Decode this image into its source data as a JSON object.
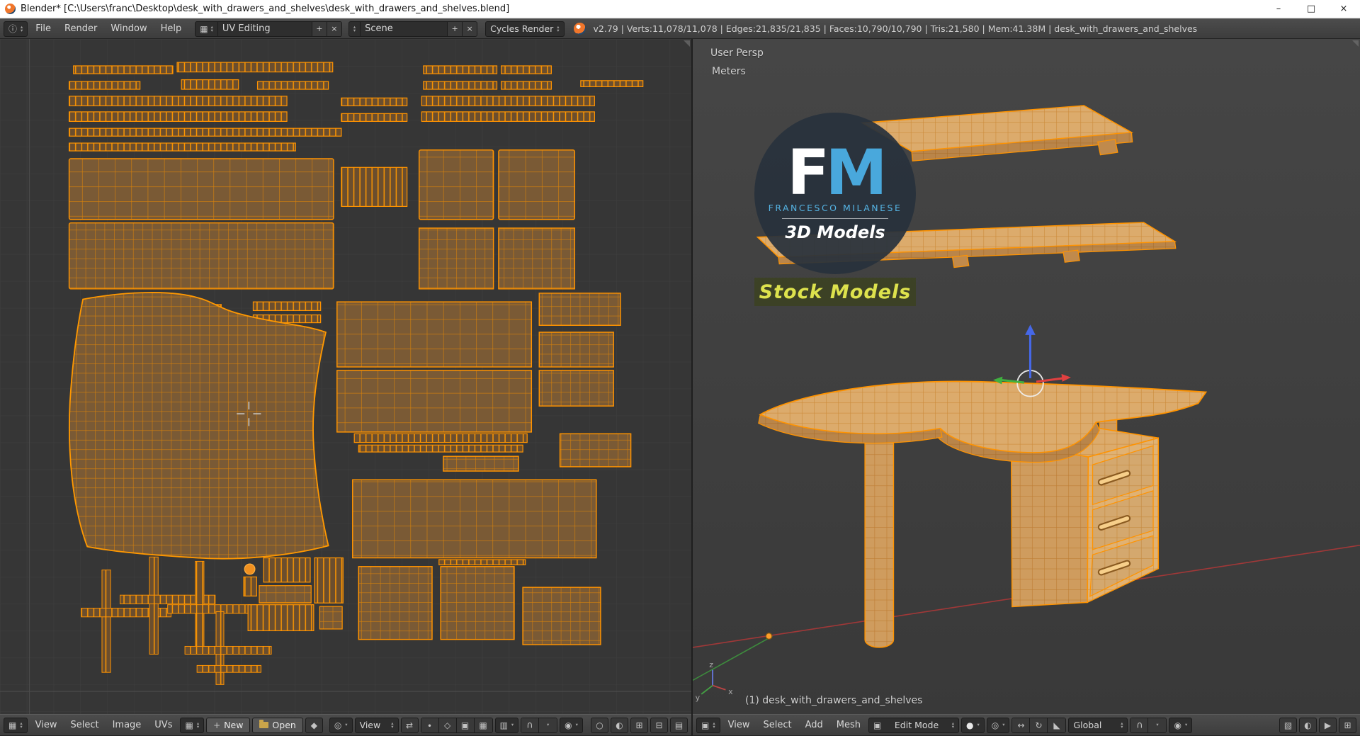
{
  "window": {
    "title": "Blender* [C:\\Users\\franc\\Desktop\\desk_with_drawers_and_shelves\\desk_with_drawers_and_shelves.blend]",
    "minimize": "–",
    "maximize": "□",
    "close": "×"
  },
  "topbar": {
    "menus": [
      "File",
      "Render",
      "Window",
      "Help"
    ],
    "layout_name": "UV Editing",
    "scene_name": "Scene",
    "engine": "Cycles Render",
    "stats": "v2.79 | Verts:11,078/11,078 | Edges:21,835/21,835 | Faces:10,790/10,790 | Tris:21,580 | Mem:41.38M | desk_with_drawers_and_shelves"
  },
  "uv_editor": {
    "menus": [
      "View",
      "Select",
      "Image",
      "UVs"
    ],
    "new_label": "New",
    "open_label": "Open",
    "channel_dropdown": "View"
  },
  "viewport": {
    "view_label": "User Persp",
    "unit_label": "Meters",
    "object_label": "(1) desk_with_drawers_and_shelves",
    "menus": [
      "View",
      "Select",
      "Add",
      "Mesh"
    ],
    "mode": "Edit Mode",
    "orientation": "Global",
    "gizmo": {
      "x": "x",
      "y": "y",
      "z": "z"
    }
  },
  "watermark": {
    "fm_f": "F",
    "fm_m": "M",
    "name": "FRANCESCO MILANESE",
    "sub": "3D Models",
    "badge": "Stock Models"
  },
  "colors": {
    "uv_wire": "#ff9300",
    "uv_face": "#7a5a35",
    "accent_blue": "#49a8dc",
    "badge_text": "#dde24d"
  },
  "icons": {
    "up": "▴",
    "down": "▾",
    "plus": "+",
    "close": "×",
    "info": "ⓘ",
    "image_editor": "▦",
    "viewport_3d": "▣",
    "datablock": "▦",
    "layout": "▦",
    "sphere": "●",
    "pivot": "◎",
    "cube": "▣",
    "sync": "⇄",
    "vertex": "∙",
    "edge": "◇",
    "face": "▣",
    "island": "▦",
    "sticky": "▥",
    "prop": "◉",
    "pin": "◆",
    "circle_a": "○",
    "circle_b": "◐",
    "tile": "⊞",
    "clip": "⊟",
    "wire": "▤",
    "translate": "↔",
    "rotate": "↻",
    "scale": "◣",
    "occlude": "▧",
    "render_still": "◐",
    "render_anim": "▶"
  }
}
